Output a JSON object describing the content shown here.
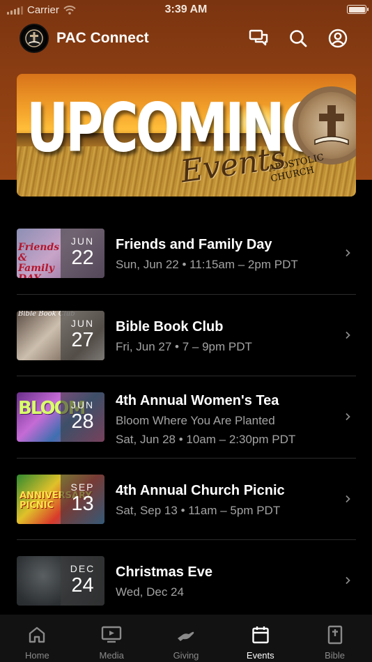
{
  "status_bar": {
    "carrier": "Carrier",
    "time": "3:39 AM"
  },
  "header": {
    "title": "PAC Connect"
  },
  "banner": {
    "headline": "UPCOMING",
    "script": "Events",
    "seal_text": "APOSTOLIC CHURCH"
  },
  "events": [
    {
      "title": "Friends and Family Day",
      "month": "JUN",
      "day": "22",
      "lines": [
        "Sun, Jun 22 • 11:15am – 2pm PDT"
      ],
      "thumb_text": "Friends & Family DAY"
    },
    {
      "title": "Bible Book Club",
      "month": "JUN",
      "day": "27",
      "lines": [
        "Fri, Jun 27 • 7 – 9pm PDT"
      ],
      "thumb_text": "Bible Book Club"
    },
    {
      "title": "4th Annual Women's Tea",
      "month": "JUN",
      "day": "28",
      "lines": [
        "Bloom Where You Are Planted",
        "Sat, Jun 28 • 10am – 2:30pm PDT"
      ],
      "thumb_text": "BLOOM"
    },
    {
      "title": "4th Annual Church Picnic",
      "month": "SEP",
      "day": "13",
      "lines": [
        "Sat, Sep 13 • 11am – 5pm PDT"
      ],
      "thumb_text": "ANNIVERSARY PICNIC"
    },
    {
      "title": "Christmas Eve",
      "month": "DEC",
      "day": "24",
      "lines": [
        "Wed, Dec 24"
      ],
      "thumb_text": ""
    }
  ],
  "tabs": [
    {
      "label": "Home",
      "icon": "home-icon"
    },
    {
      "label": "Media",
      "icon": "tv-icon"
    },
    {
      "label": "Giving",
      "icon": "giving-icon"
    },
    {
      "label": "Events",
      "icon": "calendar-icon",
      "active": true
    },
    {
      "label": "Bible",
      "icon": "bible-icon"
    }
  ],
  "colors": {
    "header_bg": "#8a3d12",
    "page_bg": "#000000",
    "tabbar_bg": "#121212",
    "muted_text": "#a3a3a3"
  }
}
